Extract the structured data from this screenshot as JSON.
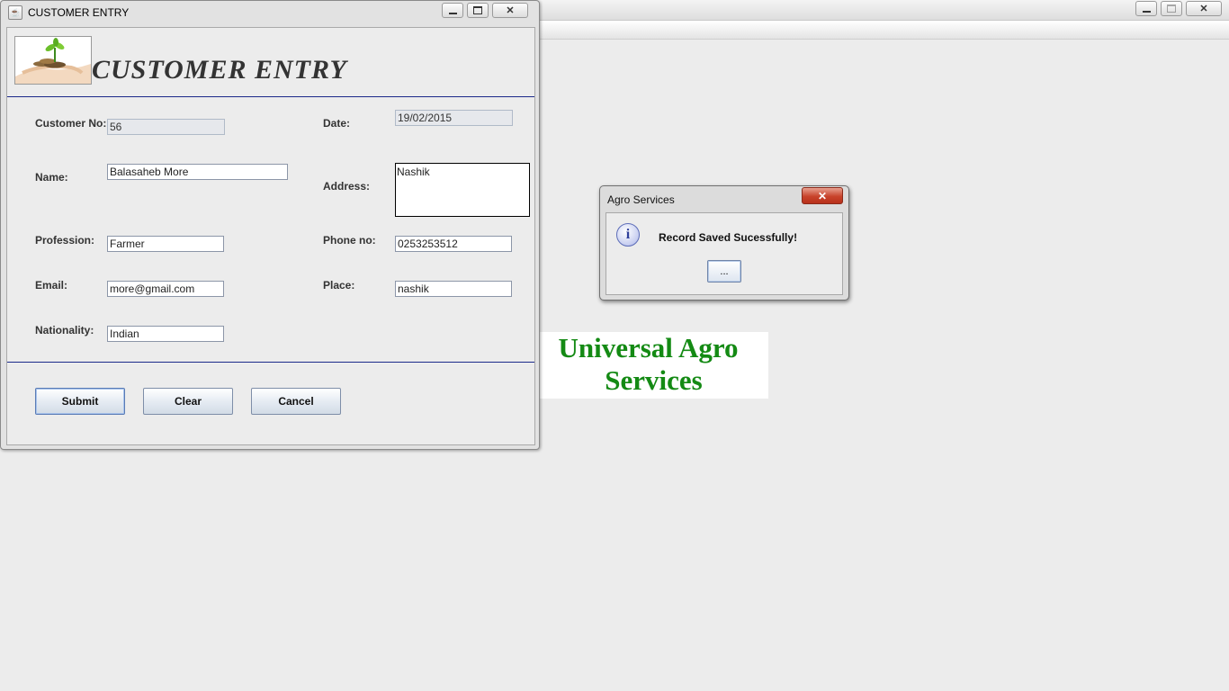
{
  "main_window": {
    "controls": {
      "minimize": "minimize-icon",
      "maximize": "maximize-icon",
      "close": "close-icon"
    }
  },
  "customer_window": {
    "title": "CUSTOMER ENTRY",
    "heading": "CUSTOMER ENTRY",
    "fields": {
      "customer_no": {
        "label": "Customer No:",
        "value": "56"
      },
      "date": {
        "label": "Date:",
        "value": "19/02/2015"
      },
      "name": {
        "label": "Name:",
        "value": "Balasaheb More"
      },
      "address": {
        "label": "Address:",
        "value": "Nashik"
      },
      "profession": {
        "label": "Profession:",
        "value": "Farmer"
      },
      "phone": {
        "label": "Phone no:",
        "value": "0253253512"
      },
      "email": {
        "label": "Email:",
        "value": "more@gmail.com"
      },
      "place": {
        "label": "Place:",
        "value": "nashik"
      },
      "nationality": {
        "label": "Nationality:",
        "value": "Indian"
      }
    },
    "buttons": {
      "submit": "Submit",
      "clear": "Clear",
      "cancel": "Cancel"
    }
  },
  "banner": {
    "line1": "Universal Agro",
    "line2": "Services"
  },
  "dialog": {
    "title": "Agro Services",
    "message": "Record Saved Sucessfully!",
    "ok_label": "..."
  },
  "colors": {
    "separator": "#1c2a8a",
    "banner_text": "#148a14",
    "close_button": "#c8432b"
  }
}
